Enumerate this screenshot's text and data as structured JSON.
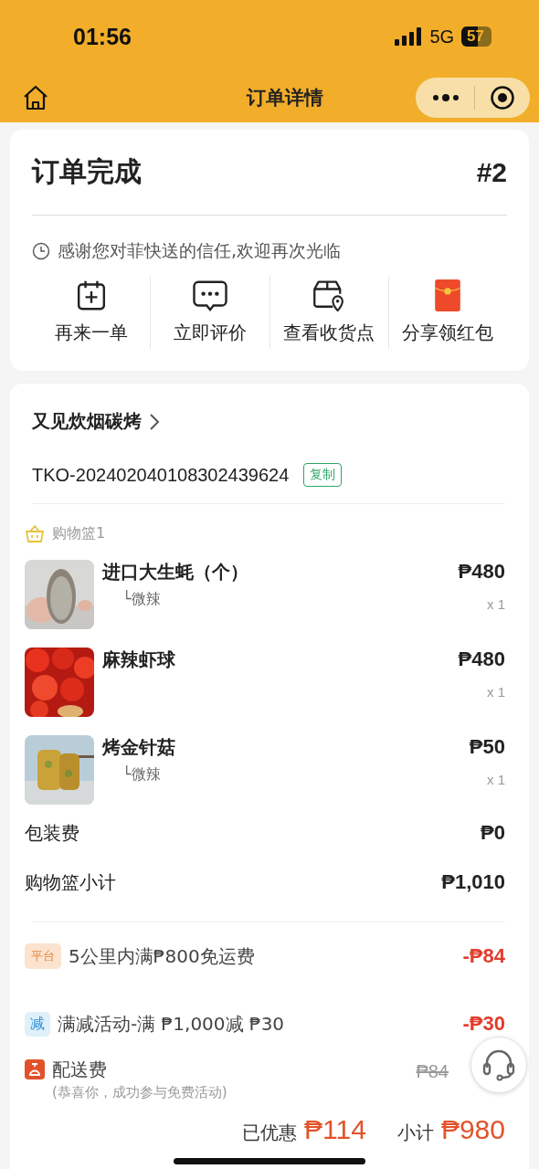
{
  "status_bar": {
    "time": "01:56",
    "network": "5G",
    "battery": "57"
  },
  "nav": {
    "title": "订单详情"
  },
  "order": {
    "status": "订单完成",
    "number": "#2",
    "message": "感谢您对菲快送的信任,欢迎再次光临",
    "actions": [
      {
        "kind": "reorder",
        "label": "再来一单"
      },
      {
        "kind": "review",
        "label": "立即评价"
      },
      {
        "kind": "pickup",
        "label": "查看收货点"
      },
      {
        "kind": "red_packet",
        "label": "分享领红包"
      }
    ]
  },
  "store": {
    "name": "又见炊烟碳烤",
    "order_id": "TKO-202402040108302439624",
    "copy_label": "复制"
  },
  "basket": {
    "label": "购物篮1",
    "items": [
      {
        "kind": "oyster",
        "name": "进口大生蚝（个）",
        "option": "└微辣",
        "price": "₱480",
        "quantity": "x 1"
      },
      {
        "kind": "shrimp",
        "name": "麻辣虾球",
        "price": "₱480",
        "quantity": "x 1"
      },
      {
        "kind": "mushroom",
        "name": "烤金针菇",
        "option": "└微辣",
        "price": "₱50",
        "quantity": "x 1"
      }
    ]
  },
  "fees": [
    {
      "label": "包装费",
      "value": "₱0"
    },
    {
      "label": "购物篮小计",
      "value": "₱1,010"
    }
  ],
  "discounts": [
    {
      "kind": "platform",
      "tag": "平台",
      "label": "5公里内满₱800免运费",
      "value": "-₱84"
    },
    {
      "kind": "reduction",
      "tag": "减",
      "label": "满减活动-满 ₱1,000减 ₱30",
      "value": "-₱30"
    }
  ],
  "delivery": {
    "label": "配送费",
    "note": "(恭喜你，成功参与免费活动)",
    "original_price": "₱84"
  },
  "footer": {
    "discount_label": "已优惠",
    "discount_value": "₱114",
    "subtotal_label": "小计",
    "subtotal_value": "₱980"
  }
}
